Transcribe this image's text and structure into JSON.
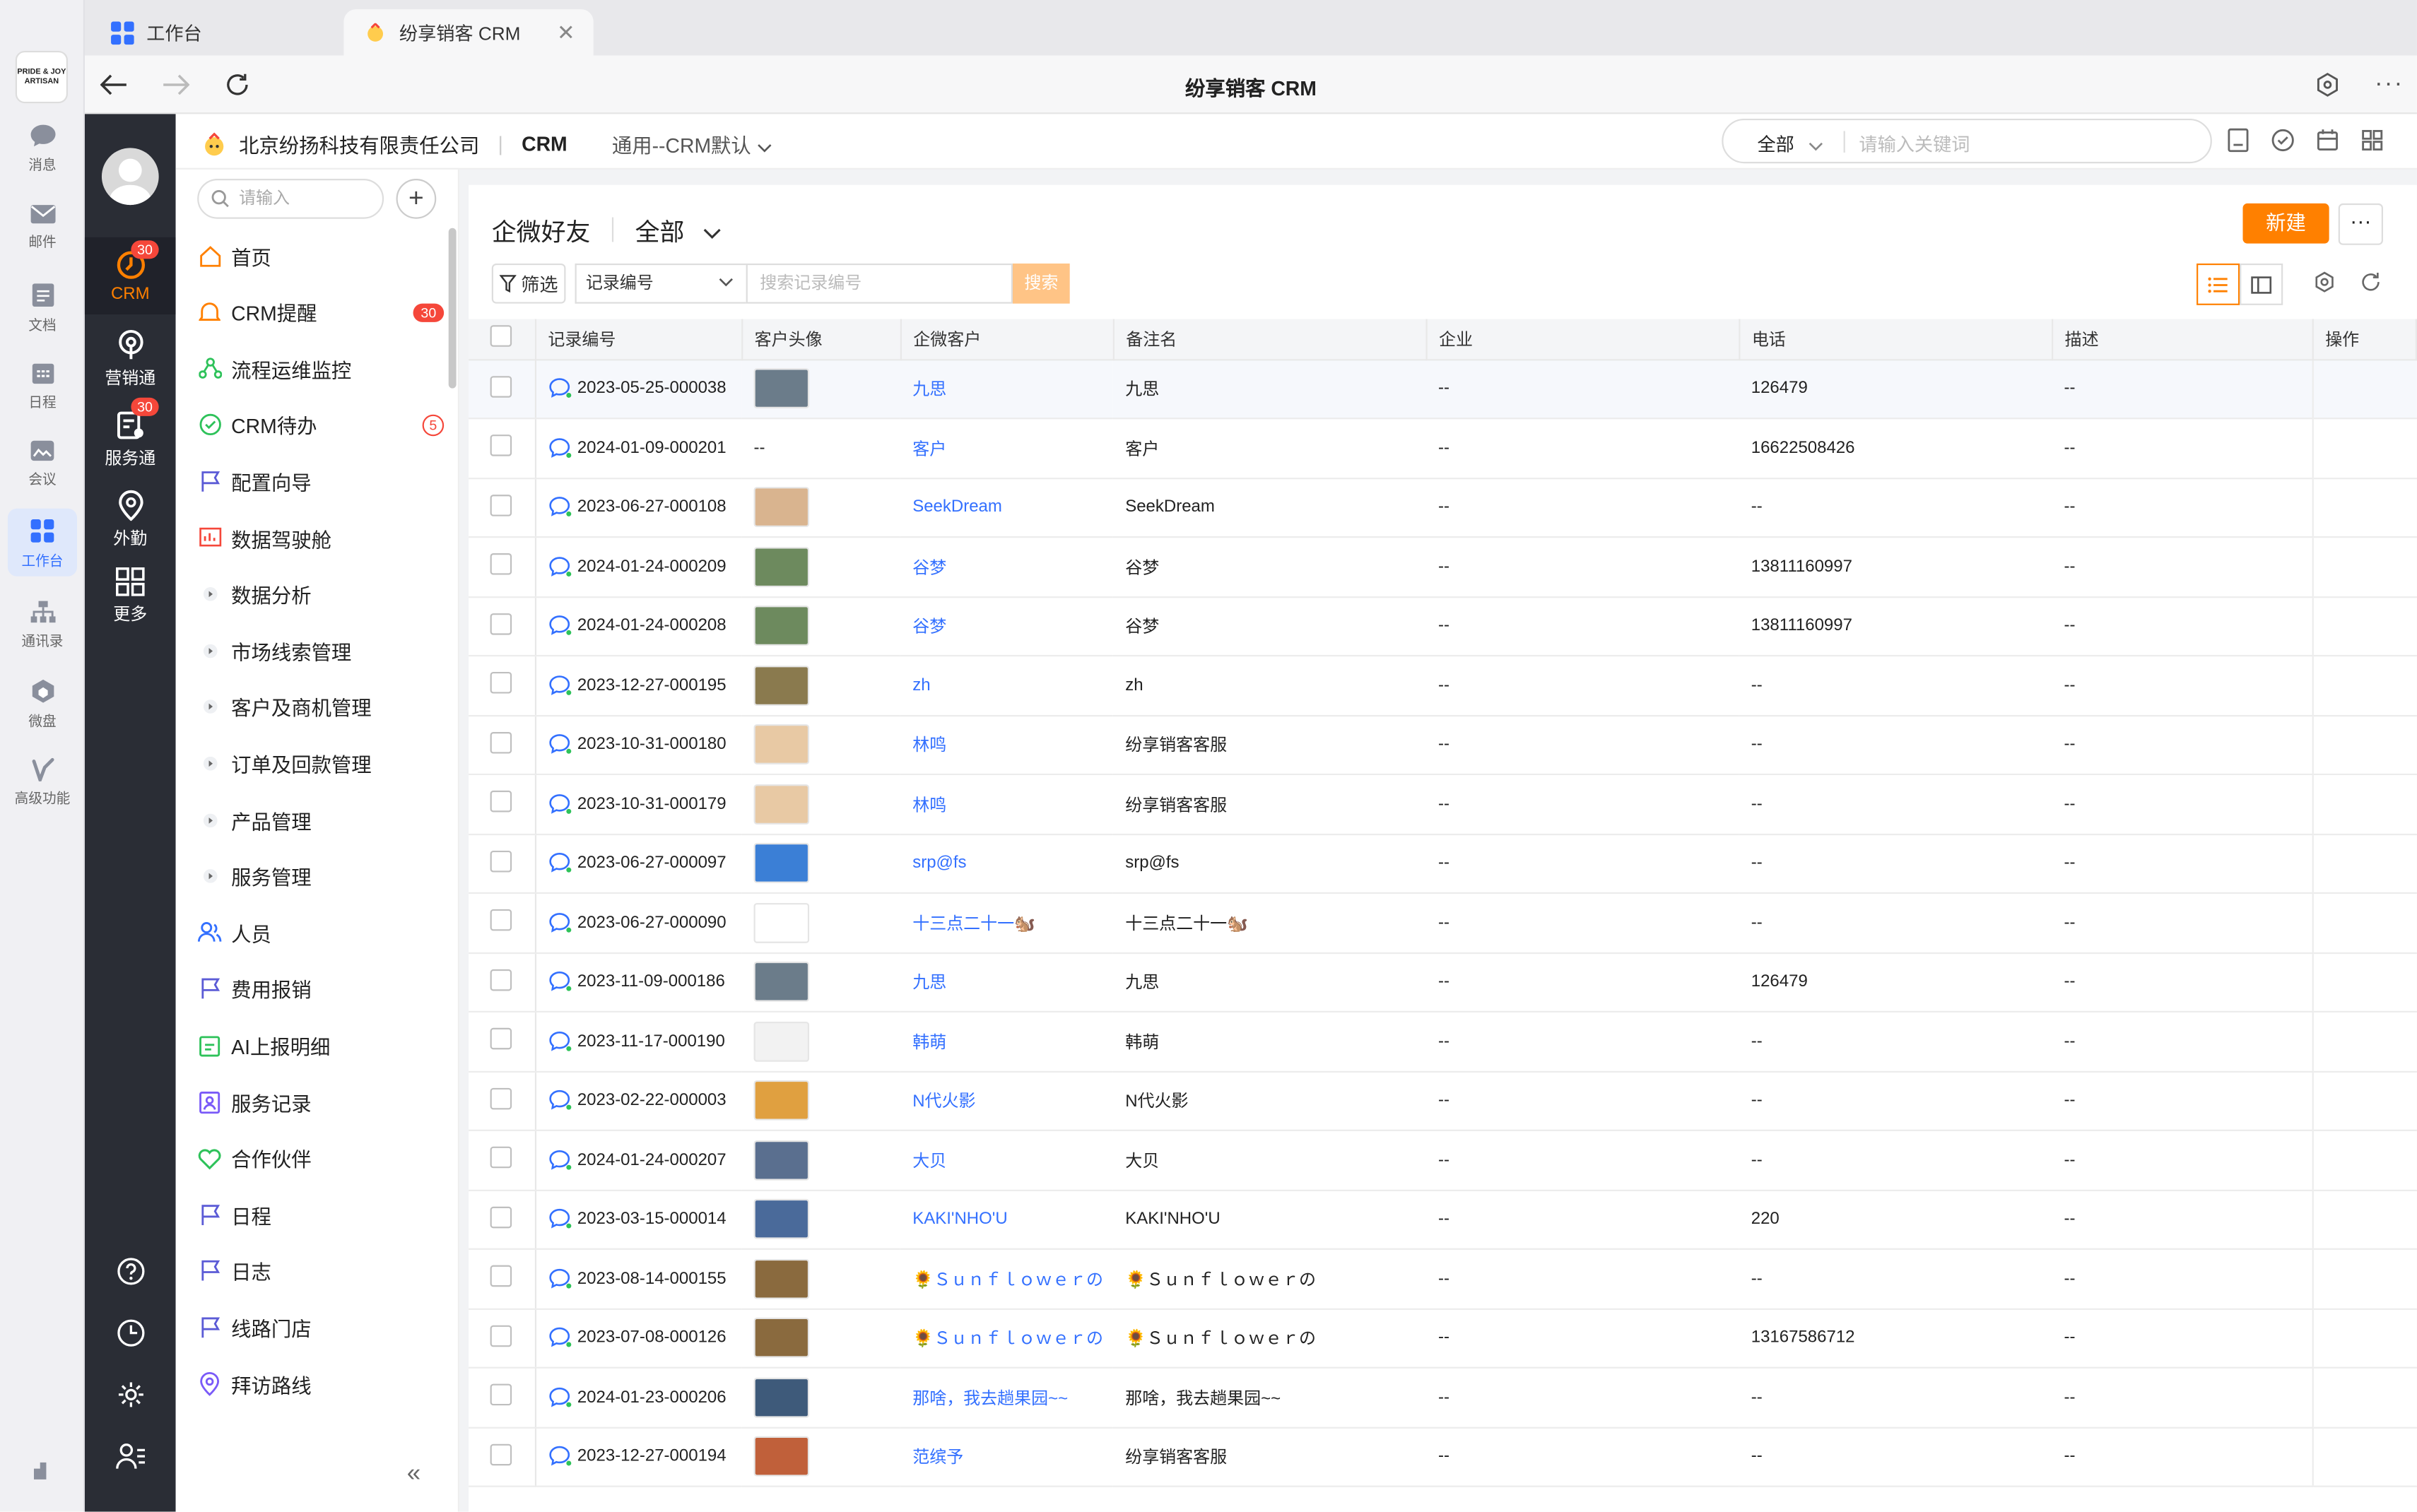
{
  "window": {
    "tabs": [
      {
        "label": "工作台"
      },
      {
        "label": "纷享销客 CRM"
      }
    ],
    "title": "纷享销客 CRM"
  },
  "rail1": {
    "logo_text": "PRIDE & JOY ARTISAN",
    "items": [
      {
        "label": "消息"
      },
      {
        "label": "邮件"
      },
      {
        "label": "文档"
      },
      {
        "label": "日程"
      },
      {
        "label": "会议"
      },
      {
        "label": "工作台"
      },
      {
        "label": "通讯录"
      },
      {
        "label": "微盘"
      },
      {
        "label": "高级功能"
      }
    ]
  },
  "rail2": {
    "items": [
      {
        "label": "CRM",
        "badge": "30"
      },
      {
        "label": "营销通",
        "badge": ""
      },
      {
        "label": "服务通",
        "badge": "30"
      },
      {
        "label": "外勤",
        "badge": ""
      },
      {
        "label": "更多",
        "badge": ""
      }
    ]
  },
  "header": {
    "company": "北京纷扬科技有限责任公司",
    "module": "CRM",
    "view": "通用--CRM默认",
    "search_scope": "全部",
    "search_placeholder": "请输入关键词"
  },
  "menu": {
    "search_placeholder": "请输入",
    "add": "+",
    "items": [
      {
        "label": "首页",
        "badge": ""
      },
      {
        "label": "CRM提醒",
        "badge": "30"
      },
      {
        "label": "流程运维监控",
        "badge": ""
      },
      {
        "label": "CRM待办",
        "badge": "5"
      },
      {
        "label": "配置向导",
        "badge": ""
      },
      {
        "label": "数据驾驶舱",
        "badge": ""
      },
      {
        "label": "数据分析",
        "badge": ""
      },
      {
        "label": "市场线索管理",
        "badge": ""
      },
      {
        "label": "客户及商机管理",
        "badge": ""
      },
      {
        "label": "订单及回款管理",
        "badge": ""
      },
      {
        "label": "产品管理",
        "badge": ""
      },
      {
        "label": "服务管理",
        "badge": ""
      },
      {
        "label": "人员",
        "badge": ""
      },
      {
        "label": "费用报销",
        "badge": ""
      },
      {
        "label": "AI上报明细",
        "badge": ""
      },
      {
        "label": "服务记录",
        "badge": ""
      },
      {
        "label": "合作伙伴",
        "badge": ""
      },
      {
        "label": "日程",
        "badge": ""
      },
      {
        "label": "日志",
        "badge": ""
      },
      {
        "label": "线路门店",
        "badge": ""
      },
      {
        "label": "拜访路线",
        "badge": ""
      }
    ],
    "collapse": "«"
  },
  "list": {
    "title": "企微好友",
    "scope": "全部",
    "new_button": "新建",
    "more_button": "···",
    "filter_button": "筛选",
    "field_select": "记录编号",
    "search_placeholder": "搜索记录编号",
    "search_button": "搜索",
    "columns": [
      "记录编号",
      "客户头像",
      "企微客户",
      "备注名",
      "企业",
      "电话",
      "描述",
      "操作"
    ],
    "rows": [
      {
        "id": "2023-05-25-000038",
        "avatar": "img",
        "customer": "九思",
        "remark": "九思",
        "company": "--",
        "phone": "126479",
        "desc": "--",
        "color": "#6b7c8a"
      },
      {
        "id": "2024-01-09-000201",
        "avatar": "--",
        "customer": "客户",
        "remark": "客户",
        "company": "--",
        "phone": "16622508426",
        "desc": "--",
        "color": ""
      },
      {
        "id": "2023-06-27-000108",
        "avatar": "img",
        "customer": "SeekDream",
        "remark": "SeekDream",
        "company": "--",
        "phone": "--",
        "desc": "--",
        "color": "#d9b48f"
      },
      {
        "id": "2024-01-24-000209",
        "avatar": "img",
        "customer": "谷梦",
        "remark": "谷梦",
        "company": "--",
        "phone": "13811160997",
        "desc": "--",
        "color": "#6d8a5e"
      },
      {
        "id": "2024-01-24-000208",
        "avatar": "img",
        "customer": "谷梦",
        "remark": "谷梦",
        "company": "--",
        "phone": "13811160997",
        "desc": "--",
        "color": "#6d8a5e"
      },
      {
        "id": "2023-12-27-000195",
        "avatar": "img",
        "customer": "zh",
        "remark": "zh",
        "company": "--",
        "phone": "--",
        "desc": "--",
        "color": "#8a7a4e"
      },
      {
        "id": "2023-10-31-000180",
        "avatar": "img",
        "customer": "林鸣",
        "remark": "纷享销客客服",
        "company": "--",
        "phone": "--",
        "desc": "--",
        "color": "#e8c9a4"
      },
      {
        "id": "2023-10-31-000179",
        "avatar": "img",
        "customer": "林鸣",
        "remark": "纷享销客客服",
        "company": "--",
        "phone": "--",
        "desc": "--",
        "color": "#e8c9a4"
      },
      {
        "id": "2023-06-27-000097",
        "avatar": "img",
        "customer": "srp@fs",
        "remark": "srp@fs",
        "company": "--",
        "phone": "--",
        "desc": "--",
        "color": "#3b7fd6"
      },
      {
        "id": "2023-06-27-000090",
        "avatar": "img",
        "customer": "十三点二十一🐿️",
        "remark": "十三点二十一🐿️",
        "company": "--",
        "phone": "--",
        "desc": "--",
        "color": "#ffffff"
      },
      {
        "id": "2023-11-09-000186",
        "avatar": "img",
        "customer": "九思",
        "remark": "九思",
        "company": "--",
        "phone": "126479",
        "desc": "--",
        "color": "#6b7c8a"
      },
      {
        "id": "2023-11-17-000190",
        "avatar": "img",
        "customer": "韩萌",
        "remark": "韩萌",
        "company": "--",
        "phone": "--",
        "desc": "--",
        "color": "#f2f2f2"
      },
      {
        "id": "2023-02-22-000003",
        "avatar": "img",
        "customer": "N代火影",
        "remark": "N代火影",
        "company": "--",
        "phone": "--",
        "desc": "--",
        "color": "#e0a040"
      },
      {
        "id": "2024-01-24-000207",
        "avatar": "img",
        "customer": "大贝",
        "remark": "大贝",
        "company": "--",
        "phone": "--",
        "desc": "--",
        "color": "#5a6f8f"
      },
      {
        "id": "2023-03-15-000014",
        "avatar": "img",
        "customer": "KAKI'NHO'U",
        "remark": "KAKI'NHO'U",
        "company": "--",
        "phone": "220",
        "desc": "--",
        "color": "#4a6a9a"
      },
      {
        "id": "2023-08-14-000155",
        "avatar": "img",
        "customer": "🌻Ｓｕｎｆｌｏｗｅｒの",
        "remark": "🌻Ｓｕｎｆｌｏｗｅｒの",
        "company": "--",
        "phone": "--",
        "desc": "--",
        "color": "#8a6a3e"
      },
      {
        "id": "2023-07-08-000126",
        "avatar": "img",
        "customer": "🌻Ｓｕｎｆｌｏｗｅｒの",
        "remark": "🌻Ｓｕｎｆｌｏｗｅｒの",
        "company": "--",
        "phone": "13167586712",
        "desc": "--",
        "color": "#8a6a3e"
      },
      {
        "id": "2024-01-23-000206",
        "avatar": "img",
        "customer": "那啥，我去趟果园~~",
        "remark": "那啥，我去趟果园~~",
        "company": "--",
        "phone": "--",
        "desc": "--",
        "color": "#3e5a7a"
      },
      {
        "id": "2023-12-27-000194",
        "avatar": "img",
        "customer": "范缤予",
        "remark": "纷享销客客服",
        "company": "--",
        "phone": "--",
        "desc": "--",
        "color": "#c0603a"
      }
    ]
  }
}
